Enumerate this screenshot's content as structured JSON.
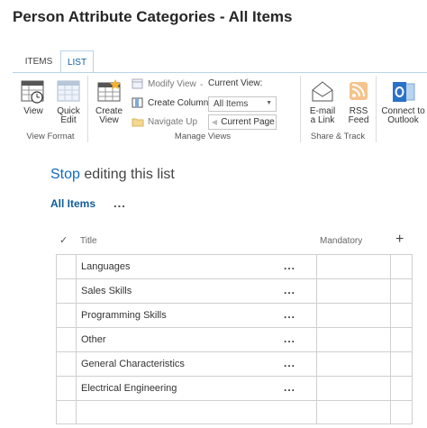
{
  "page": {
    "title": "Person Attribute Categories - All Items"
  },
  "ribbon": {
    "tabs": [
      {
        "label": "ITEMS"
      },
      {
        "label": "LIST"
      }
    ],
    "view_format": {
      "group_label": "View Format",
      "view_label": "View",
      "quick_edit_label": "Quick Edit"
    },
    "manage_views": {
      "group_label": "Manage Views",
      "create_view_label": "Create View",
      "modify_view_label": "Modify View",
      "create_column_label": "Create Column",
      "navigate_up_label": "Navigate Up",
      "current_view_label": "Current View:",
      "current_view_value": "All Items",
      "current_page_label": "Current Page"
    },
    "share_track": {
      "group_label": "Share & Track",
      "email_link_label": "E-mail a Link",
      "rss_feed_label": "RSS Feed"
    },
    "connect": {
      "outlook_label": "Connect to Outlook"
    }
  },
  "edit_bar": {
    "stop_label": "Stop",
    "rest_label": " editing this list"
  },
  "views": {
    "active_view": "All Items",
    "more_label": "..."
  },
  "list": {
    "columns": {
      "check": "✓",
      "title": "Title",
      "mandatory": "Mandatory",
      "add": "+"
    },
    "rows": [
      {
        "title": "Languages",
        "menu": "...",
        "mandatory": ""
      },
      {
        "title": "Sales Skills",
        "menu": "...",
        "mandatory": ""
      },
      {
        "title": "Programming Skills",
        "menu": "...",
        "mandatory": ""
      },
      {
        "title": "Other",
        "menu": "...",
        "mandatory": ""
      },
      {
        "title": "General Characteristics",
        "menu": "...",
        "mandatory": ""
      },
      {
        "title": "Electrical Engineering",
        "menu": "...",
        "mandatory": ""
      },
      {
        "title": "",
        "menu": "",
        "mandatory": ""
      }
    ]
  },
  "colors": {
    "accent": "#0f6bbd",
    "tab_border": "#b8d3ea",
    "outlook_blue": "#2a72c8",
    "rss_orange": "#f0a24a"
  }
}
